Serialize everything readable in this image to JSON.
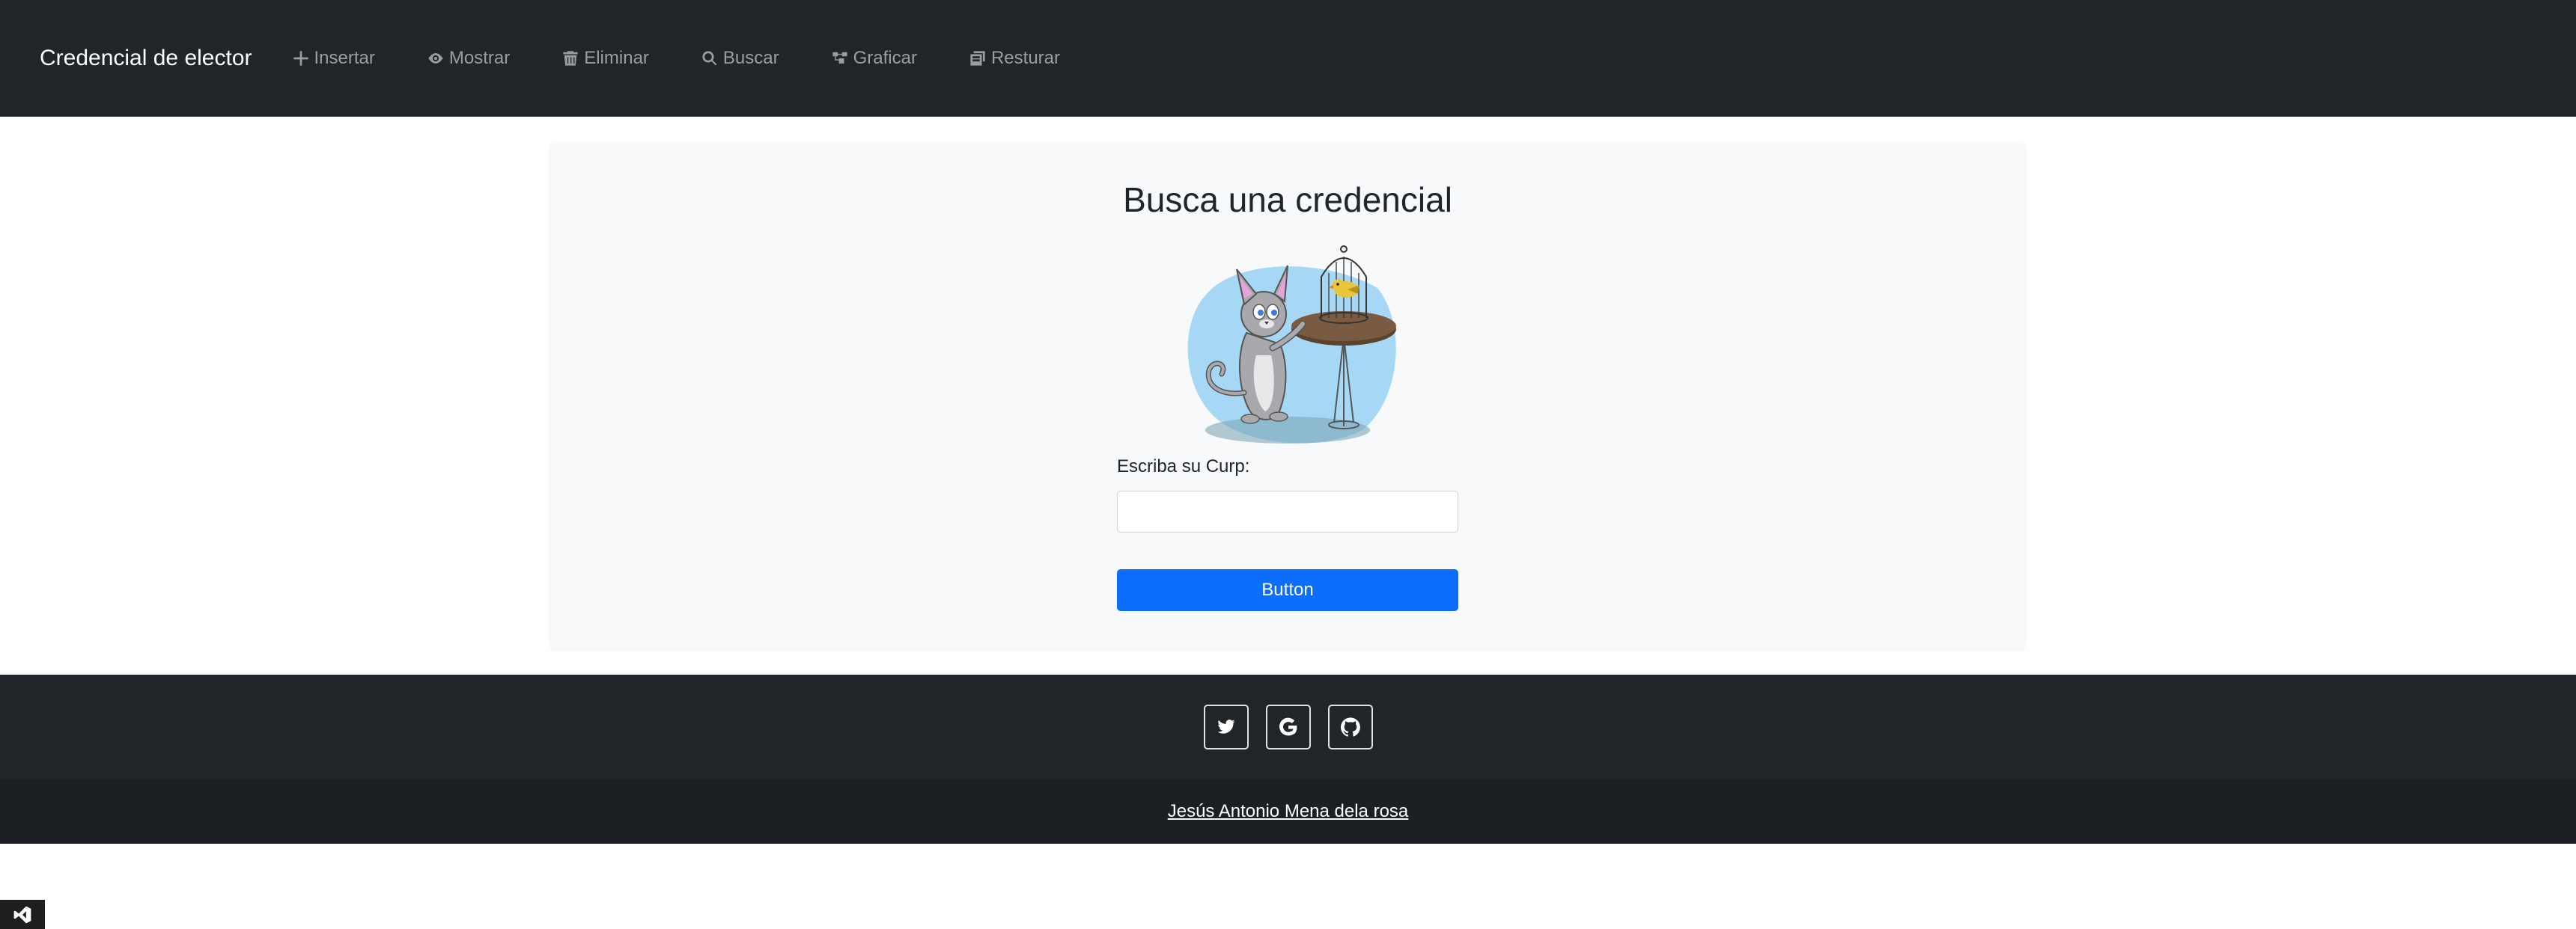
{
  "navbar": {
    "brand": "Credencial de elector",
    "items": [
      {
        "label": "Insertar",
        "icon": "plus-icon"
      },
      {
        "label": "Mostrar",
        "icon": "eye-icon"
      },
      {
        "label": "Eliminar",
        "icon": "trash-icon"
      },
      {
        "label": "Buscar",
        "icon": "search-icon"
      },
      {
        "label": "Graficar",
        "icon": "diagram-icon"
      },
      {
        "label": "Resturar",
        "icon": "restore-icon"
      }
    ]
  },
  "main": {
    "title": "Busca una credencial",
    "illustration": "cat-and-bird-illustration",
    "curp_label": "Escriba su Curp:",
    "curp_value": "",
    "curp_placeholder": "",
    "button_label": "Button"
  },
  "footer": {
    "social": [
      "twitter-icon",
      "google-icon",
      "github-icon"
    ],
    "credit": "Jesús Antonio Mena dela rosa"
  },
  "colors": {
    "navbar_bg": "#212529",
    "footer_bottom_bg": "#1c1f23",
    "card_bg": "#f8f9fa",
    "primary": "#0d6efd"
  }
}
